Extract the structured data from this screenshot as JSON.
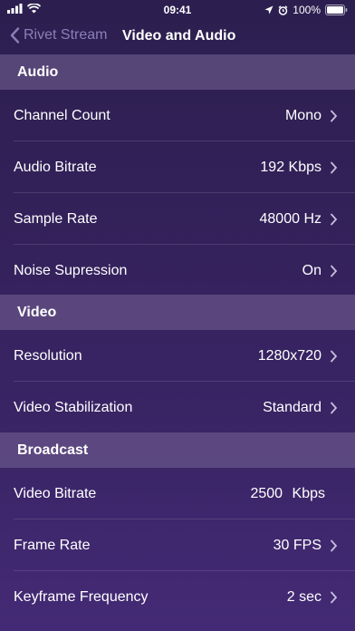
{
  "status": {
    "time": "09:41",
    "battery": "100%",
    "icons": [
      "signal-icon",
      "wifi-icon",
      "location-icon",
      "alarm-icon",
      "battery-icon"
    ]
  },
  "nav": {
    "back_label": "Rivet Stream",
    "title": "Video and Audio"
  },
  "sections": {
    "audio": "Audio",
    "video": "Video",
    "broadcast": "Broadcast"
  },
  "rows": {
    "channel_count": {
      "label": "Channel Count",
      "value": "Mono"
    },
    "audio_bitrate": {
      "label": "Audio Bitrate",
      "value": "192 Kbps"
    },
    "sample_rate": {
      "label": "Sample Rate",
      "value": "48000 Hz"
    },
    "noise_supression": {
      "label": "Noise Supression",
      "value": "On"
    },
    "resolution": {
      "label": "Resolution",
      "value": "1280x720"
    },
    "video_stabilization": {
      "label": "Video Stabilization",
      "value": "Standard"
    },
    "video_bitrate": {
      "label": "Video Bitrate",
      "value": "2500",
      "unit": "Kbps"
    },
    "frame_rate": {
      "label": "Frame Rate",
      "value": "30 FPS"
    },
    "keyframe_frequency": {
      "label": "Keyframe Frequency",
      "value": "2 sec"
    }
  },
  "colors": {
    "background_top": "#2c1f4f",
    "background_bottom": "#442a75",
    "accent_back": "#8c7fb8"
  }
}
